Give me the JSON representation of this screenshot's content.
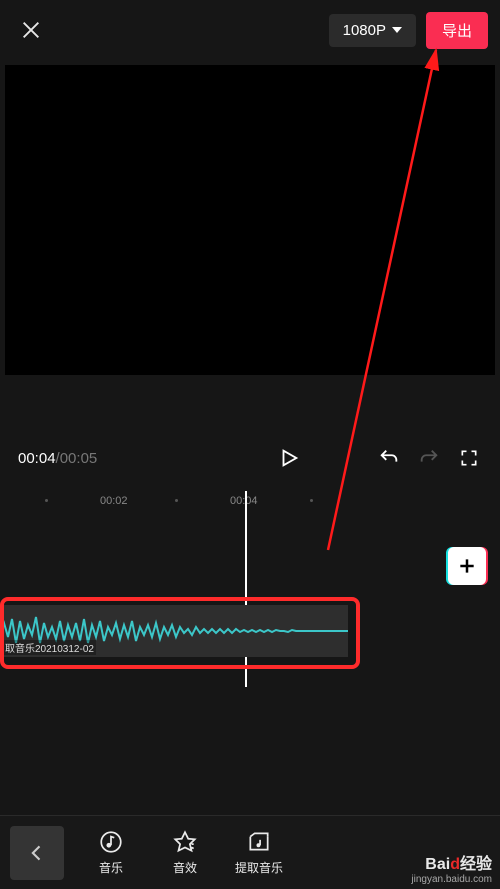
{
  "topbar": {
    "resolution_label": "1080P",
    "export_label": "导出"
  },
  "playback": {
    "current_time": "00:04",
    "total_time": "00:05"
  },
  "ruler": {
    "ticks": [
      "00:02",
      "00:04"
    ]
  },
  "audio_clip": {
    "label": "取音乐20210312-02"
  },
  "toolbar": {
    "items": [
      {
        "id": "music",
        "label": "音乐"
      },
      {
        "id": "sfx",
        "label": "音效"
      },
      {
        "id": "extract",
        "label": "提取音乐"
      }
    ]
  },
  "watermark": {
    "line1_a": "Bai",
    "line1_b": "d",
    "line1_c": "经验",
    "line2": "jingyan.baidu.com"
  }
}
